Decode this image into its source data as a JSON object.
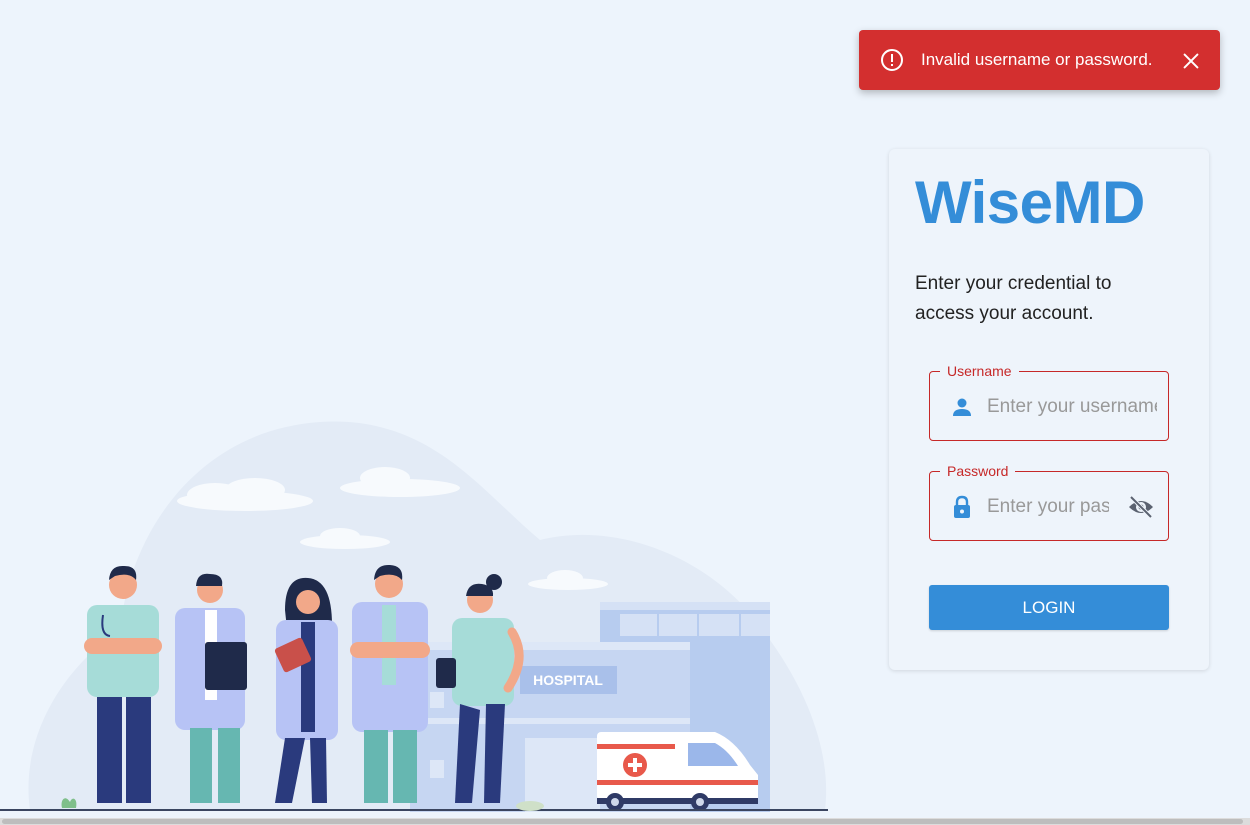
{
  "toast": {
    "message": "Invalid username or password.",
    "icon": "error-outline-icon",
    "close_icon": "close-icon",
    "color": "#d32f2f"
  },
  "illustration": {
    "building_sign": "HOSPITAL"
  },
  "login": {
    "brand": "WiseMD",
    "subtitle": "Enter your credential to access your account.",
    "username": {
      "label": "Username",
      "placeholder": "Enter your username",
      "value": "",
      "icon": "person-icon"
    },
    "password": {
      "label": "Password",
      "placeholder": "Enter your password",
      "value": "",
      "icon": "lock-icon",
      "toggle_icon": "eye-off-icon"
    },
    "button_label": "LOGIN",
    "colors": {
      "brand": "#348dd8",
      "error": "#c62828",
      "background": "#edf4fc"
    }
  }
}
